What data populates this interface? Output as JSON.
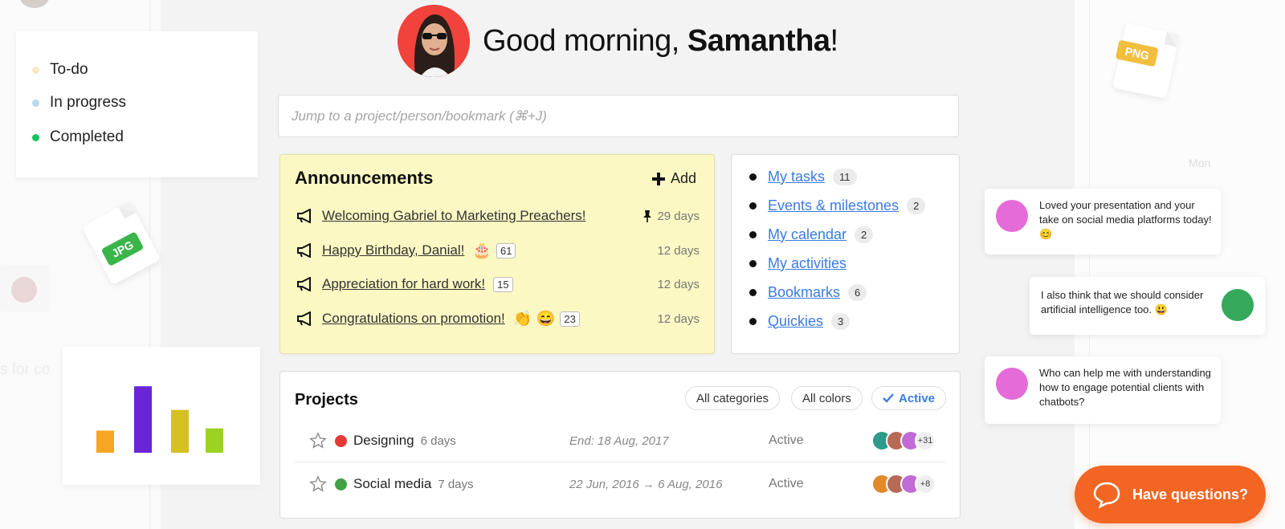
{
  "greeting": {
    "prefix": "Good morning, ",
    "name": "Samantha",
    "suffix": "!"
  },
  "search": {
    "placeholder": "Jump to a project/person/bookmark (⌘+J)"
  },
  "status_legend": {
    "items": [
      {
        "label": "To-do",
        "color": "#fbe6c8"
      },
      {
        "label": "In progress",
        "color": "#b9d7f3"
      },
      {
        "label": "Completed",
        "color": "#17c45d"
      }
    ]
  },
  "file_badges": {
    "jpg": "JPG",
    "png": "PNG"
  },
  "decor_chart": {
    "chart_data": {
      "type": "bar",
      "values": [
        30,
        90,
        58,
        33
      ],
      "colors": [
        "#f5a623",
        "#6b24d6",
        "#d6c020",
        "#9ad321"
      ]
    }
  },
  "announcements": {
    "title": "Announcements",
    "add_label": "Add",
    "items": [
      {
        "text": "Welcoming Gabriel to Marketing Preachers!",
        "emoji": "",
        "count": "",
        "pinned": true,
        "days": "29 days"
      },
      {
        "text": "Happy Birthday, Danial!",
        "emoji": "🎂",
        "count": "61",
        "pinned": false,
        "days": "12 days"
      },
      {
        "text": "Appreciation for hard work!",
        "emoji": "",
        "count": "15",
        "pinned": false,
        "days": "12 days"
      },
      {
        "text": "Congratulations on promotion!",
        "emoji": "👏 😄",
        "count": "23",
        "pinned": false,
        "days": "12 days"
      }
    ]
  },
  "quick_links": {
    "items": [
      {
        "label": "My tasks",
        "count": "11"
      },
      {
        "label": "Events & milestones",
        "count": "2"
      },
      {
        "label": "My calendar",
        "count": "2"
      },
      {
        "label": "My activities",
        "count": ""
      },
      {
        "label": "Bookmarks",
        "count": "6"
      },
      {
        "label": "Quickies",
        "count": "3"
      }
    ]
  },
  "projects": {
    "title": "Projects",
    "filters": {
      "categories": "All categories",
      "colors": "All colors",
      "active": "Active"
    },
    "rows": [
      {
        "name": "Designing",
        "duration": "6 days",
        "dates": "End: 18 Aug, 2017",
        "status": "Active",
        "color": "#e53935",
        "more": "+31"
      },
      {
        "name": "Social media",
        "duration": "7 days",
        "dates": "22 Jun, 2016 → 6 Aug, 2016",
        "status": "Active",
        "color": "#43a047",
        "more": "+8"
      }
    ]
  },
  "chat": {
    "messages": [
      {
        "text": "Loved your presentation and your take on social media platforms today! 😊"
      },
      {
        "text": "I also think that we should consider artificial intelligence too. 😃"
      },
      {
        "text": "Who can help me with understanding how to engage potential clients with chatbots?"
      }
    ]
  },
  "help": {
    "label": "Have questions?"
  },
  "background_text": {
    "fragment": "s for co",
    "calendar_day": "Mon"
  }
}
